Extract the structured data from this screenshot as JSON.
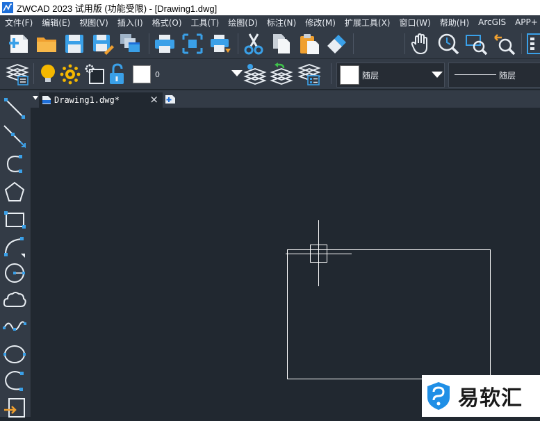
{
  "window": {
    "title": "ZWCAD 2023 试用版 (功能受限) - [Drawing1.dwg]"
  },
  "menu": {
    "items": [
      "文件(F)",
      "编辑(E)",
      "视图(V)",
      "插入(I)",
      "格式(O)",
      "工具(T)",
      "绘图(D)",
      "标注(N)",
      "修改(M)",
      "扩展工具(X)",
      "窗口(W)",
      "帮助(H)",
      "ArcGIS",
      "APP+"
    ]
  },
  "layer_toolbar": {
    "current_layer": "0"
  },
  "properties": {
    "color_label": "随层",
    "linetype_label": "随层"
  },
  "tabs": {
    "active_tab": "Drawing1.dwg*",
    "close_glyph": "×"
  },
  "watermark": {
    "text": "易软汇"
  },
  "colors": {
    "background": "#212830",
    "panel": "#333b46",
    "accent_blue": "#3aa0e8",
    "icon_yellow": "#f5b800",
    "icon_orange": "#f0a030"
  }
}
